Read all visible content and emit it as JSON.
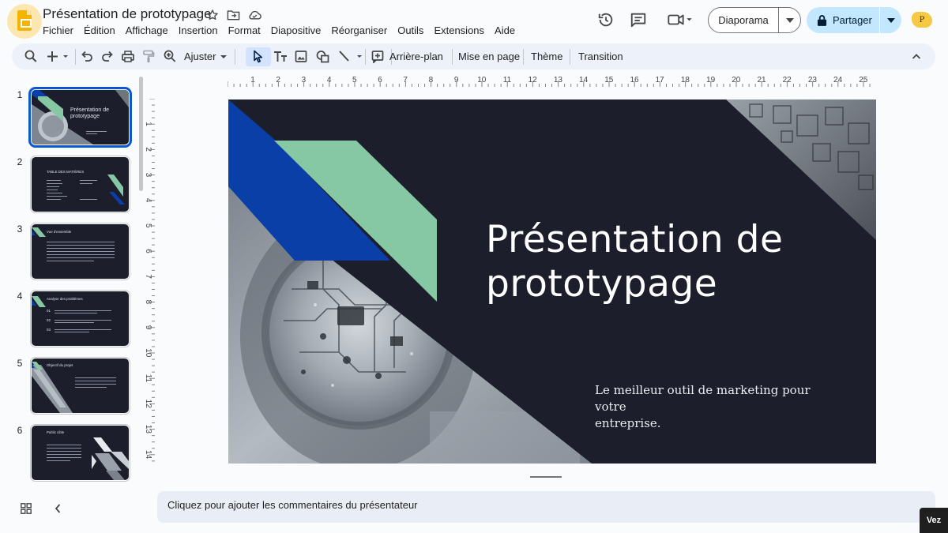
{
  "header": {
    "doc_title": "Présentation de prototypage",
    "icons": [
      "star-icon",
      "move-folder-icon",
      "cloud-status-icon"
    ],
    "menu": [
      "Fichier",
      "Édition",
      "Affichage",
      "Insertion",
      "Format",
      "Diapositive",
      "Réorganiser",
      "Outils",
      "Extensions",
      "Aide"
    ],
    "slideshow_label": "Diaporama",
    "share_label": "Partager",
    "avatar_initial": "P",
    "accent_color": "#c2e7ff"
  },
  "toolbar": {
    "zoom_label": "Ajuster",
    "background_label": "Arrière-plan",
    "layout_label": "Mise en page",
    "theme_label": "Thème",
    "transition_label": "Transition"
  },
  "ruler": {
    "horizontal": [
      "1",
      "2",
      "3",
      "4",
      "5",
      "6",
      "7",
      "8",
      "9",
      "10",
      "11",
      "12",
      "13",
      "14",
      "15",
      "16",
      "17",
      "18",
      "19",
      "20",
      "21",
      "22",
      "23",
      "24",
      "25"
    ],
    "vertical": [
      "1",
      "2",
      "3",
      "4",
      "5",
      "6",
      "7",
      "8",
      "9",
      "10",
      "11",
      "12",
      "13",
      "14"
    ]
  },
  "filmstrip": {
    "selected_slide": 1,
    "slides": [
      {
        "num": "1",
        "title": "Présentation de prototypage"
      },
      {
        "num": "2",
        "title": "TABLE DES MATIÈRES"
      },
      {
        "num": "3",
        "title": "Vue d'ensemble"
      },
      {
        "num": "4",
        "title": "Analyse des problèmes",
        "items": [
          "01",
          "02",
          "03"
        ]
      },
      {
        "num": "5",
        "title": "Objectif du projet"
      },
      {
        "num": "6",
        "title": "Public cible"
      }
    ]
  },
  "slide": {
    "title_line1": "Présentation de",
    "title_line2": "prototypage",
    "subtitle_line1": "Le meilleur outil de marketing pour votre",
    "subtitle_line2": "entreprise.",
    "colors": {
      "background": "#1c1f2b",
      "blue": "#0a3fa8",
      "green": "#86c7a4"
    }
  },
  "notes": {
    "placeholder": "Cliquez pour ajouter les commentaires du présentateur"
  },
  "corner_badge": "Vez"
}
